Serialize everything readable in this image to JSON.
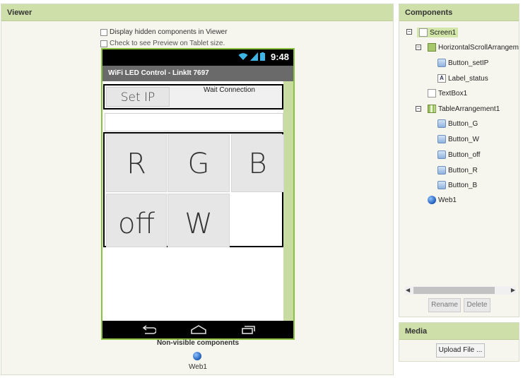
{
  "viewer": {
    "header": "Viewer",
    "option_hidden": "Display hidden components in Viewer",
    "option_tablet": "Check to see Preview on Tablet size.",
    "phone": {
      "time": "9:48",
      "title": "WiFi LED Control - LinkIt 7697",
      "set_ip_label": "Set IP",
      "status_label": "Wait Connection",
      "buttons": {
        "r": "R",
        "g": "G",
        "b": "B",
        "off": "off",
        "w": "W"
      }
    },
    "nonvisible_title": "Non-visible components",
    "nonvisible_items": [
      "Web1"
    ]
  },
  "components": {
    "header": "Components",
    "tree": {
      "screen": "Screen1",
      "hsa": "HorizontalScrollArrangem",
      "button_setip": "Button_setIP",
      "label_status": "Label_status",
      "textbox": "TextBox1",
      "table": "TableArrangement1",
      "button_g": "Button_G",
      "button_w": "Button_W",
      "button_off": "Button_off",
      "button_r": "Button_R",
      "button_b": "Button_B",
      "web": "Web1"
    },
    "rename_label": "Rename",
    "delete_label": "Delete"
  },
  "media": {
    "header": "Media",
    "upload_label": "Upload File ..."
  },
  "colors": {
    "panel_header": "#cfdfaa",
    "phone_border": "#8ac23f",
    "selected": "#d2e6a9"
  }
}
